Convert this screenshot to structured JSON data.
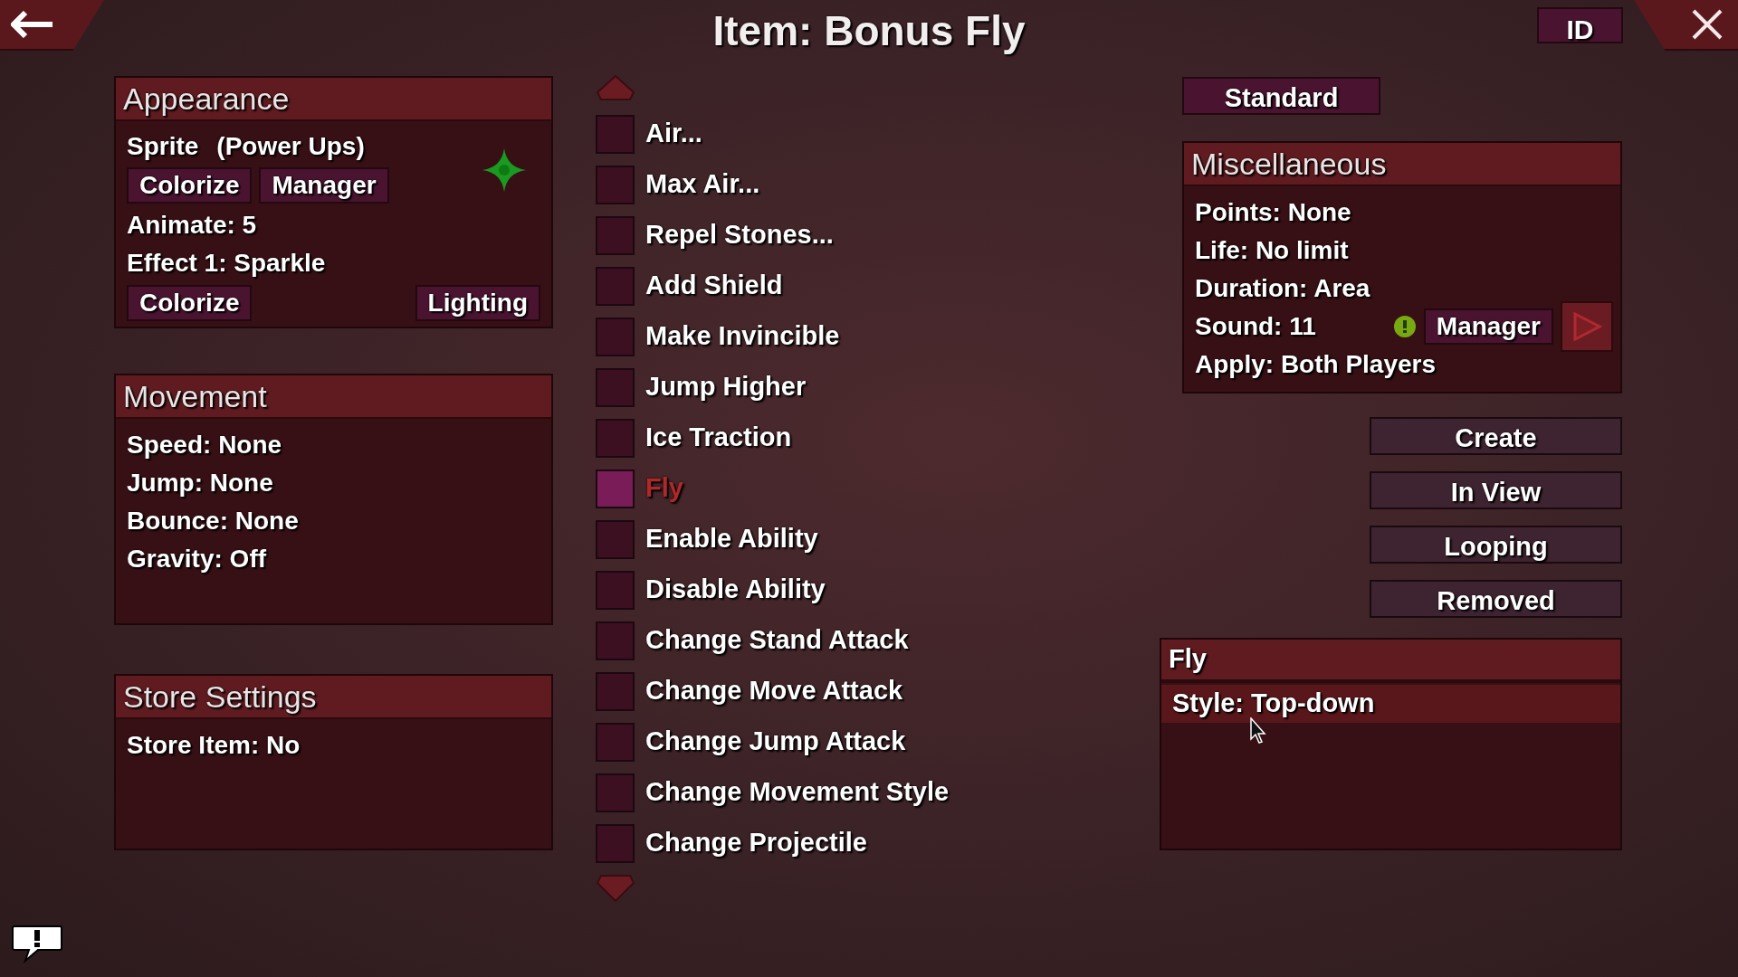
{
  "title": "Item: Bonus Fly",
  "id_button": "ID",
  "appearance": {
    "title": "Appearance",
    "rows": [
      {
        "kind": "sprite",
        "label": "Sprite",
        "value": "(Power Ups)"
      },
      {
        "kind": "buttons",
        "buttons": [
          "Colorize",
          "Manager"
        ],
        "spread": false
      },
      {
        "kind": "text",
        "text": "Animate: 5"
      },
      {
        "kind": "text",
        "text": "Effect 1: Sparkle"
      },
      {
        "kind": "buttons",
        "buttons": [
          "Colorize",
          "Lighting"
        ],
        "spread": true
      }
    ]
  },
  "movement": {
    "title": "Movement",
    "rows": [
      {
        "kind": "text",
        "text": "Speed: None"
      },
      {
        "kind": "text",
        "text": "Jump: None"
      },
      {
        "kind": "text",
        "text": "Bounce: None"
      },
      {
        "kind": "text",
        "text": "Gravity: Off"
      }
    ]
  },
  "store": {
    "title": "Store Settings",
    "rows": [
      {
        "kind": "text",
        "text": "Store Item: No"
      }
    ]
  },
  "effects": [
    {
      "label": "Air...",
      "checked": false
    },
    {
      "label": "Max Air...",
      "checked": false
    },
    {
      "label": "Repel Stones...",
      "checked": false
    },
    {
      "label": "Add Shield",
      "checked": false
    },
    {
      "label": "Make Invincible",
      "checked": false
    },
    {
      "label": "Jump Higher",
      "checked": false
    },
    {
      "label": "Ice Traction",
      "checked": false
    },
    {
      "label": "Fly",
      "checked": true
    },
    {
      "label": "Enable Ability",
      "checked": false
    },
    {
      "label": "Disable Ability",
      "checked": false
    },
    {
      "label": "Change Stand Attack",
      "checked": false
    },
    {
      "label": "Change Move Attack",
      "checked": false
    },
    {
      "label": "Change Jump Attack",
      "checked": false
    },
    {
      "label": "Change Movement Style",
      "checked": false
    },
    {
      "label": "Change Projectile",
      "checked": false
    }
  ],
  "mode_button": "Standard",
  "misc": {
    "title": "Miscellaneous",
    "rows": [
      {
        "kind": "text",
        "text": "Points: None"
      },
      {
        "kind": "text",
        "text": "Life: No limit"
      },
      {
        "kind": "text",
        "text": "Duration: Area"
      },
      {
        "kind": "sound",
        "text": "Sound: 11",
        "button": "Manager"
      },
      {
        "kind": "text",
        "text": "Apply: Both Players"
      }
    ]
  },
  "action_buttons": [
    "Create",
    "In View",
    "Looping",
    "Removed"
  ],
  "fly": {
    "title": "Fly",
    "rows": [
      {
        "text": "Style: Top-down",
        "selected": true
      }
    ]
  }
}
